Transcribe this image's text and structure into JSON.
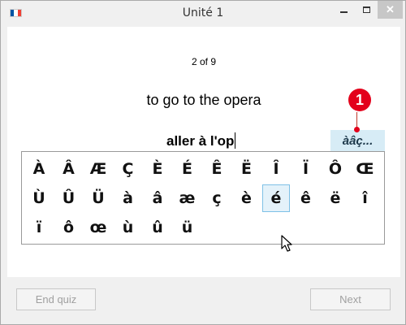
{
  "window": {
    "title": "Unité 1",
    "flag_colors": [
      "#0055a4",
      "#ffffff",
      "#ef4135"
    ],
    "controls": {
      "minimize_icon": "minimize-icon",
      "maximize_icon": "maximize-icon",
      "close_label": "✕"
    }
  },
  "quiz": {
    "counter": "2 of 9",
    "prompt": "to go to the opera",
    "answer_value": "aller à l'op",
    "accent_toggle_label": "àâç..."
  },
  "annotation": {
    "number": "1",
    "color": "#e3001b"
  },
  "accent_palette": {
    "rows": [
      [
        "À",
        "Â",
        "Æ",
        "Ç",
        "È",
        "É",
        "Ê",
        "Ë",
        "Î",
        "Ï",
        "Ô",
        "Œ"
      ],
      [
        "Ù",
        "Û",
        "Ü",
        "à",
        "â",
        "æ",
        "ç",
        "è",
        "é",
        "ê",
        "ë",
        "î"
      ],
      [
        "ï",
        "ô",
        "œ",
        "ù",
        "û",
        "ü"
      ]
    ],
    "selected": "é",
    "selected_color": "#e4f2fa"
  },
  "footer": {
    "end_quiz_label": "End quiz",
    "next_label": "Next"
  }
}
